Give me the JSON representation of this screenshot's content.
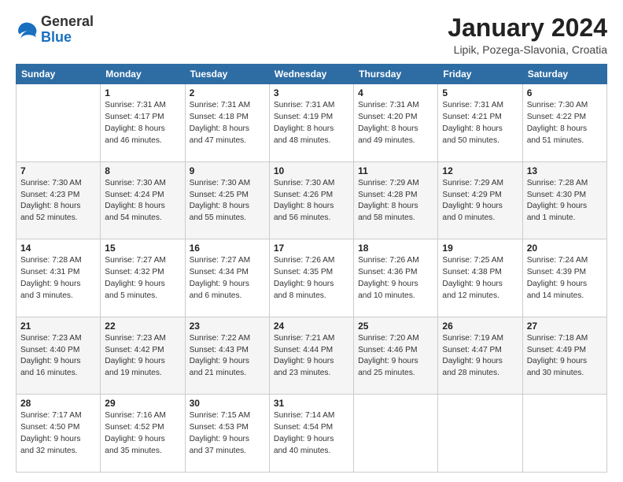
{
  "header": {
    "logo_general": "General",
    "logo_blue": "Blue",
    "month_title": "January 2024",
    "location": "Lipik, Pozega-Slavonia, Croatia"
  },
  "calendar": {
    "headers": [
      "Sunday",
      "Monday",
      "Tuesday",
      "Wednesday",
      "Thursday",
      "Friday",
      "Saturday"
    ],
    "rows": [
      [
        {
          "day": "",
          "info": ""
        },
        {
          "day": "1",
          "info": "Sunrise: 7:31 AM\nSunset: 4:17 PM\nDaylight: 8 hours\nand 46 minutes."
        },
        {
          "day": "2",
          "info": "Sunrise: 7:31 AM\nSunset: 4:18 PM\nDaylight: 8 hours\nand 47 minutes."
        },
        {
          "day": "3",
          "info": "Sunrise: 7:31 AM\nSunset: 4:19 PM\nDaylight: 8 hours\nand 48 minutes."
        },
        {
          "day": "4",
          "info": "Sunrise: 7:31 AM\nSunset: 4:20 PM\nDaylight: 8 hours\nand 49 minutes."
        },
        {
          "day": "5",
          "info": "Sunrise: 7:31 AM\nSunset: 4:21 PM\nDaylight: 8 hours\nand 50 minutes."
        },
        {
          "day": "6",
          "info": "Sunrise: 7:30 AM\nSunset: 4:22 PM\nDaylight: 8 hours\nand 51 minutes."
        }
      ],
      [
        {
          "day": "7",
          "info": "Sunrise: 7:30 AM\nSunset: 4:23 PM\nDaylight: 8 hours\nand 52 minutes."
        },
        {
          "day": "8",
          "info": "Sunrise: 7:30 AM\nSunset: 4:24 PM\nDaylight: 8 hours\nand 54 minutes."
        },
        {
          "day": "9",
          "info": "Sunrise: 7:30 AM\nSunset: 4:25 PM\nDaylight: 8 hours\nand 55 minutes."
        },
        {
          "day": "10",
          "info": "Sunrise: 7:30 AM\nSunset: 4:26 PM\nDaylight: 8 hours\nand 56 minutes."
        },
        {
          "day": "11",
          "info": "Sunrise: 7:29 AM\nSunset: 4:28 PM\nDaylight: 8 hours\nand 58 minutes."
        },
        {
          "day": "12",
          "info": "Sunrise: 7:29 AM\nSunset: 4:29 PM\nDaylight: 9 hours\nand 0 minutes."
        },
        {
          "day": "13",
          "info": "Sunrise: 7:28 AM\nSunset: 4:30 PM\nDaylight: 9 hours\nand 1 minute."
        }
      ],
      [
        {
          "day": "14",
          "info": "Sunrise: 7:28 AM\nSunset: 4:31 PM\nDaylight: 9 hours\nand 3 minutes."
        },
        {
          "day": "15",
          "info": "Sunrise: 7:27 AM\nSunset: 4:32 PM\nDaylight: 9 hours\nand 5 minutes."
        },
        {
          "day": "16",
          "info": "Sunrise: 7:27 AM\nSunset: 4:34 PM\nDaylight: 9 hours\nand 6 minutes."
        },
        {
          "day": "17",
          "info": "Sunrise: 7:26 AM\nSunset: 4:35 PM\nDaylight: 9 hours\nand 8 minutes."
        },
        {
          "day": "18",
          "info": "Sunrise: 7:26 AM\nSunset: 4:36 PM\nDaylight: 9 hours\nand 10 minutes."
        },
        {
          "day": "19",
          "info": "Sunrise: 7:25 AM\nSunset: 4:38 PM\nDaylight: 9 hours\nand 12 minutes."
        },
        {
          "day": "20",
          "info": "Sunrise: 7:24 AM\nSunset: 4:39 PM\nDaylight: 9 hours\nand 14 minutes."
        }
      ],
      [
        {
          "day": "21",
          "info": "Sunrise: 7:23 AM\nSunset: 4:40 PM\nDaylight: 9 hours\nand 16 minutes."
        },
        {
          "day": "22",
          "info": "Sunrise: 7:23 AM\nSunset: 4:42 PM\nDaylight: 9 hours\nand 19 minutes."
        },
        {
          "day": "23",
          "info": "Sunrise: 7:22 AM\nSunset: 4:43 PM\nDaylight: 9 hours\nand 21 minutes."
        },
        {
          "day": "24",
          "info": "Sunrise: 7:21 AM\nSunset: 4:44 PM\nDaylight: 9 hours\nand 23 minutes."
        },
        {
          "day": "25",
          "info": "Sunrise: 7:20 AM\nSunset: 4:46 PM\nDaylight: 9 hours\nand 25 minutes."
        },
        {
          "day": "26",
          "info": "Sunrise: 7:19 AM\nSunset: 4:47 PM\nDaylight: 9 hours\nand 28 minutes."
        },
        {
          "day": "27",
          "info": "Sunrise: 7:18 AM\nSunset: 4:49 PM\nDaylight: 9 hours\nand 30 minutes."
        }
      ],
      [
        {
          "day": "28",
          "info": "Sunrise: 7:17 AM\nSunset: 4:50 PM\nDaylight: 9 hours\nand 32 minutes."
        },
        {
          "day": "29",
          "info": "Sunrise: 7:16 AM\nSunset: 4:52 PM\nDaylight: 9 hours\nand 35 minutes."
        },
        {
          "day": "30",
          "info": "Sunrise: 7:15 AM\nSunset: 4:53 PM\nDaylight: 9 hours\nand 37 minutes."
        },
        {
          "day": "31",
          "info": "Sunrise: 7:14 AM\nSunset: 4:54 PM\nDaylight: 9 hours\nand 40 minutes."
        },
        {
          "day": "",
          "info": ""
        },
        {
          "day": "",
          "info": ""
        },
        {
          "day": "",
          "info": ""
        }
      ]
    ]
  }
}
